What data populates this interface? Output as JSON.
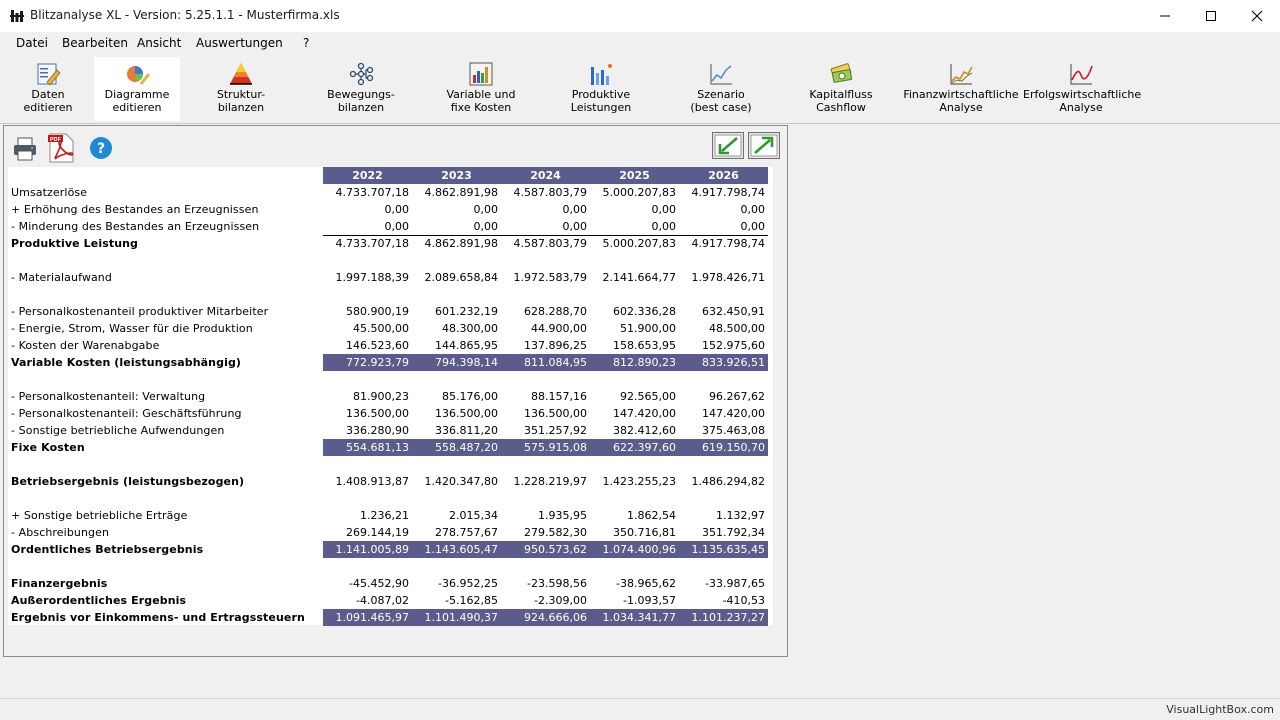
{
  "window": {
    "title": "Blitzanalyse XL - Version: 5.25.1.1 - Musterfirma.xls",
    "controls": [
      "minimize-icon",
      "maximize-icon",
      "close-icon"
    ]
  },
  "menu": [
    "Datei",
    "Bearbeiten",
    "Ansicht",
    "Auswertungen",
    "?"
  ],
  "toolbar": [
    {
      "label": "Daten\neditieren",
      "icon": "data-edit-icon",
      "active": false
    },
    {
      "label": "Diagramme\neditieren",
      "icon": "diagram-edit-icon",
      "active": true
    },
    {
      "label": "Struktur-\nbilanzen",
      "icon": "pyramid-icon",
      "active": false
    },
    {
      "label": "Bewegungs-\nbilanzen",
      "icon": "tree-icon",
      "active": false
    },
    {
      "label": "Variable und\nfixe Kosten",
      "icon": "bar-chart-icon",
      "active": false
    },
    {
      "label": "Produktive\nLeistungen",
      "icon": "column-chart-icon",
      "active": false
    },
    {
      "label": "Szenario\n(best case)",
      "icon": "line-chart-icon",
      "active": false
    },
    {
      "label": "Kapitalfluss\nCashflow",
      "icon": "money-icon",
      "active": false
    },
    {
      "label": "Finanzwirtschaftliche\nAnalyse",
      "icon": "finance-chart-icon",
      "active": false
    },
    {
      "label": "Erfolgswirtschaftliche\nAnalyse",
      "icon": "success-chart-icon",
      "active": false
    }
  ],
  "panel_tools": [
    "printer-icon",
    "pdf-icon",
    "help-icon",
    "collapse-arrow-icon",
    "expand-arrow-icon"
  ],
  "colors": {
    "header_bg": "#5b5b8c",
    "header_text": "#ffffff"
  },
  "table": {
    "years": [
      "2022",
      "2023",
      "2024",
      "2025",
      "2026"
    ],
    "rows": [
      {
        "label": "Umsatzerlöse",
        "values": [
          "4.733.707,18",
          "4.862.891,98",
          "4.587.803,79",
          "5.000.207,83",
          "4.917.798,74"
        ],
        "style": ""
      },
      {
        "label": "+ Erhöhung des Bestandes an Erzeugnissen",
        "values": [
          "0,00",
          "0,00",
          "0,00",
          "0,00",
          "0,00"
        ],
        "style": ""
      },
      {
        "label": "- Minderung des Bestandes an Erzeugnissen",
        "values": [
          "0,00",
          "0,00",
          "0,00",
          "0,00",
          "0,00"
        ],
        "style": ""
      },
      {
        "label": "Produktive Leistung",
        "values": [
          "4.733.707,18",
          "4.862.891,98",
          "4.587.803,79",
          "5.000.207,83",
          "4.917.798,74"
        ],
        "style": "bold line"
      },
      {
        "label": "",
        "values": [
          "",
          "",
          "",
          "",
          ""
        ],
        "style": ""
      },
      {
        "label": "- Materialaufwand",
        "values": [
          "1.997.188,39",
          "2.089.658,84",
          "1.972.583,79",
          "2.141.664,77",
          "1.978.426,71"
        ],
        "style": ""
      },
      {
        "label": "",
        "values": [
          "",
          "",
          "",
          "",
          ""
        ],
        "style": ""
      },
      {
        "label": "- Personalkostenanteil produktiver Mitarbeiter",
        "values": [
          "580.900,19",
          "601.232,19",
          "628.288,70",
          "602.336,28",
          "632.450,91"
        ],
        "style": ""
      },
      {
        "label": "- Energie, Strom, Wasser für die Produktion",
        "values": [
          "45.500,00",
          "48.300,00",
          "44.900,00",
          "51.900,00",
          "48.500,00"
        ],
        "style": ""
      },
      {
        "label": "- Kosten der Warenabgabe",
        "values": [
          "146.523,60",
          "144.865,95",
          "137.896,25",
          "158.653,95",
          "152.975,60"
        ],
        "style": ""
      },
      {
        "label": "Variable Kosten (leistungsabhängig)",
        "values": [
          "772.923,79",
          "794.398,14",
          "811.084,95",
          "812.890,23",
          "833.926,51"
        ],
        "style": "bold hl"
      },
      {
        "label": "",
        "values": [
          "",
          "",
          "",
          "",
          ""
        ],
        "style": ""
      },
      {
        "label": "- Personalkostenanteil: Verwaltung",
        "values": [
          "81.900,23",
          "85.176,00",
          "88.157,16",
          "92.565,00",
          "96.267,62"
        ],
        "style": ""
      },
      {
        "label": "- Personalkostenanteil: Geschäftsführung",
        "values": [
          "136.500,00",
          "136.500,00",
          "136.500,00",
          "147.420,00",
          "147.420,00"
        ],
        "style": ""
      },
      {
        "label": "- Sonstige betriebliche Aufwendungen",
        "values": [
          "336.280,90",
          "336.811,20",
          "351.257,92",
          "382.412,60",
          "375.463,08"
        ],
        "style": ""
      },
      {
        "label": "Fixe Kosten",
        "values": [
          "554.681,13",
          "558.487,20",
          "575.915,08",
          "622.397,60",
          "619.150,70"
        ],
        "style": "bold hl"
      },
      {
        "label": "",
        "values": [
          "",
          "",
          "",
          "",
          ""
        ],
        "style": ""
      },
      {
        "label": "Betriebsergebnis (leistungsbezogen)",
        "values": [
          "1.408.913,87",
          "1.420.347,80",
          "1.228.219,97",
          "1.423.255,23",
          "1.486.294,82"
        ],
        "style": "bold"
      },
      {
        "label": "",
        "values": [
          "",
          "",
          "",
          "",
          ""
        ],
        "style": ""
      },
      {
        "label": "+ Sonstige betriebliche Erträge",
        "values": [
          "1.236,21",
          "2.015,34",
          "1.935,95",
          "1.862,54",
          "1.132,97"
        ],
        "style": ""
      },
      {
        "label": "- Abschreibungen",
        "values": [
          "269.144,19",
          "278.757,67",
          "279.582,30",
          "350.716,81",
          "351.792,34"
        ],
        "style": ""
      },
      {
        "label": "Ordentliches Betriebsergebnis",
        "values": [
          "1.141.005,89",
          "1.143.605,47",
          "950.573,62",
          "1.074.400,96",
          "1.135.635,45"
        ],
        "style": "bold hl"
      },
      {
        "label": "",
        "values": [
          "",
          "",
          "",
          "",
          ""
        ],
        "style": ""
      },
      {
        "label": "Finanzergebnis",
        "values": [
          "-45.452,90",
          "-36.952,25",
          "-23.598,56",
          "-38.965,62",
          "-33.987,65"
        ],
        "style": "bold"
      },
      {
        "label": "Außerordentliches Ergebnis",
        "values": [
          "-4.087,02",
          "-5.162,85",
          "-2.309,00",
          "-1.093,57",
          "-410,53"
        ],
        "style": "bold"
      },
      {
        "label": "Ergebnis vor Einkommens- und Ertragssteuern",
        "values": [
          "1.091.465,97",
          "1.101.490,37",
          "924.666,06",
          "1.034.341,77",
          "1.101.237,27"
        ],
        "style": "bold hl"
      }
    ]
  },
  "status": {
    "watermark": "VisualLightBox.com"
  }
}
